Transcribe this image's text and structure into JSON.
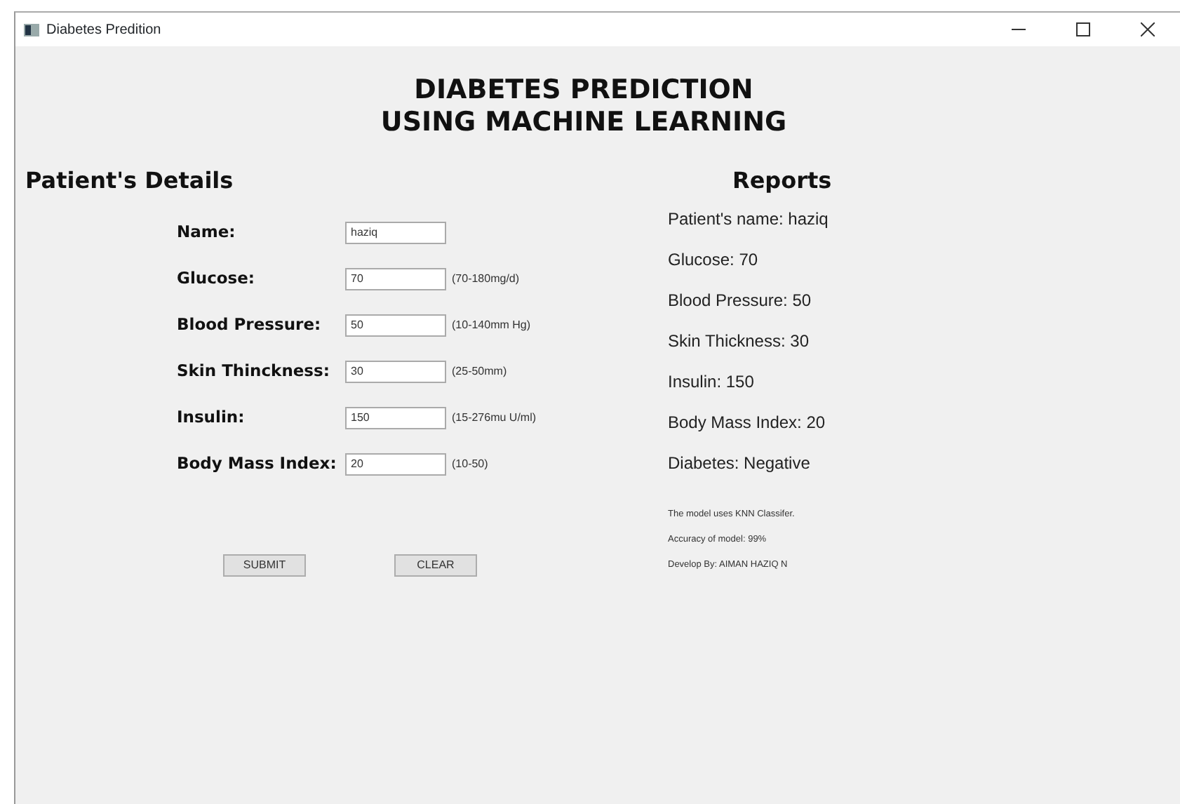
{
  "window": {
    "title": "Diabetes Predition"
  },
  "heading": [
    "DIABETES PREDICTION",
    "USING MACHINE LEARNING"
  ],
  "details": {
    "title": "Patient's Details",
    "fields": [
      {
        "label": "Name:",
        "value": "haziq"
      },
      {
        "label": "Glucose:",
        "value": "70",
        "hint": "(70-180mg/d)"
      },
      {
        "label": "Blood Pressure:",
        "value": "50",
        "hint": "(10-140mm Hg)"
      },
      {
        "label": "Skin Thinckness:",
        "value": "30",
        "hint": "(25-50mm)"
      },
      {
        "label": "Insulin:",
        "value": "150",
        "hint": "(15-276mu U/ml)"
      },
      {
        "label": "Body Mass Index:",
        "value": "20",
        "hint": "(10-50)"
      }
    ],
    "buttons": [
      "SUBMIT",
      "CLEAR"
    ]
  },
  "reports": {
    "title": "Reports",
    "lines": [
      "Patient's name: haziq",
      "Glucose: 70",
      "Blood Pressure: 50",
      "Skin Thickness: 30",
      "Insulin: 150",
      "Body Mass Index: 20",
      "Diabetes: Negative"
    ],
    "notes": [
      "The model uses KNN Classifer.",
      "Accuracy of model: 99%",
      "Develop By: AIMAN HAZIQ N"
    ]
  }
}
